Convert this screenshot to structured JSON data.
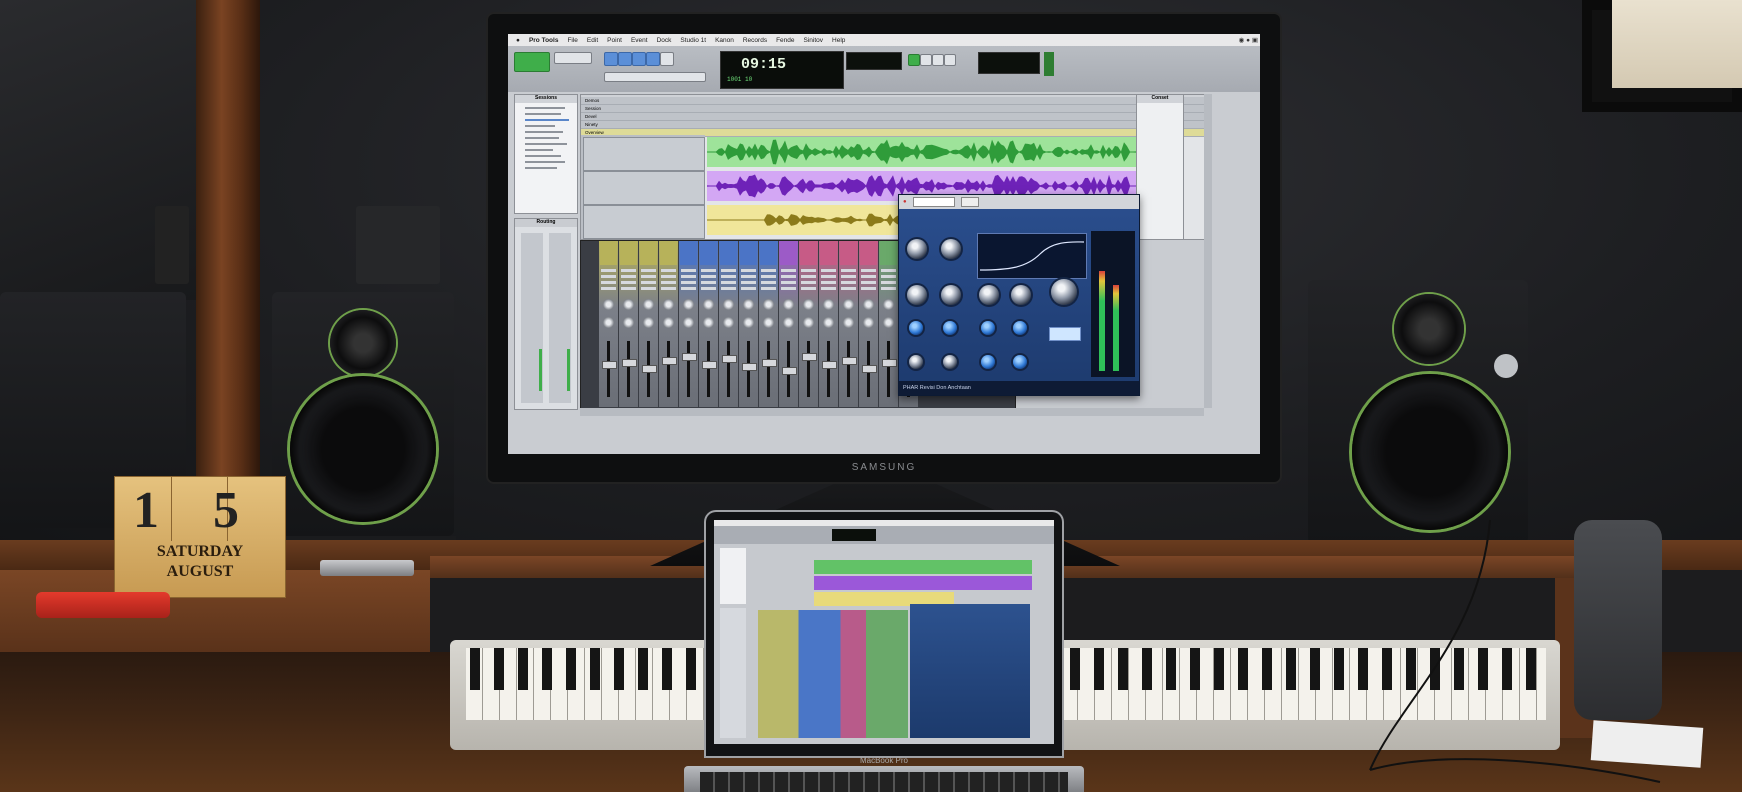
{
  "scene": {
    "description_colors": {
      "accent_green": "#6fa04a",
      "wave_green": "#41b84a",
      "wave_purple": "#8b3ad6",
      "wave_yellow": "#b8a32a",
      "plugin_blue": "#2b4f8f"
    }
  },
  "monitor": {
    "brand": "SAMSUNG",
    "menubar": {
      "app_name": "Pro Tools",
      "items": [
        "File",
        "Edit",
        "Point",
        "Event",
        "Dock",
        "Studio 1t",
        "Kanon",
        "Records",
        "Fende",
        "Sinitov",
        "Help"
      ]
    },
    "counter": {
      "main_time": "09:15",
      "sub_display": "1001 10"
    },
    "panels": {
      "session": "Sessions",
      "routing": "Routing",
      "markers": "Conset"
    },
    "edit_rows": [
      "Demos",
      "Session",
      "Devel",
      "Ninety",
      "Overview"
    ],
    "plugin": {
      "footer_text": "PHAR Revisi Don Anchtaan"
    }
  },
  "laptop": {
    "label": "MacBook Pro"
  },
  "calendar": {
    "day_digit_1": "1",
    "day_digit_2": "5",
    "weekday": "SATURDAY",
    "month": "AUGUST"
  }
}
